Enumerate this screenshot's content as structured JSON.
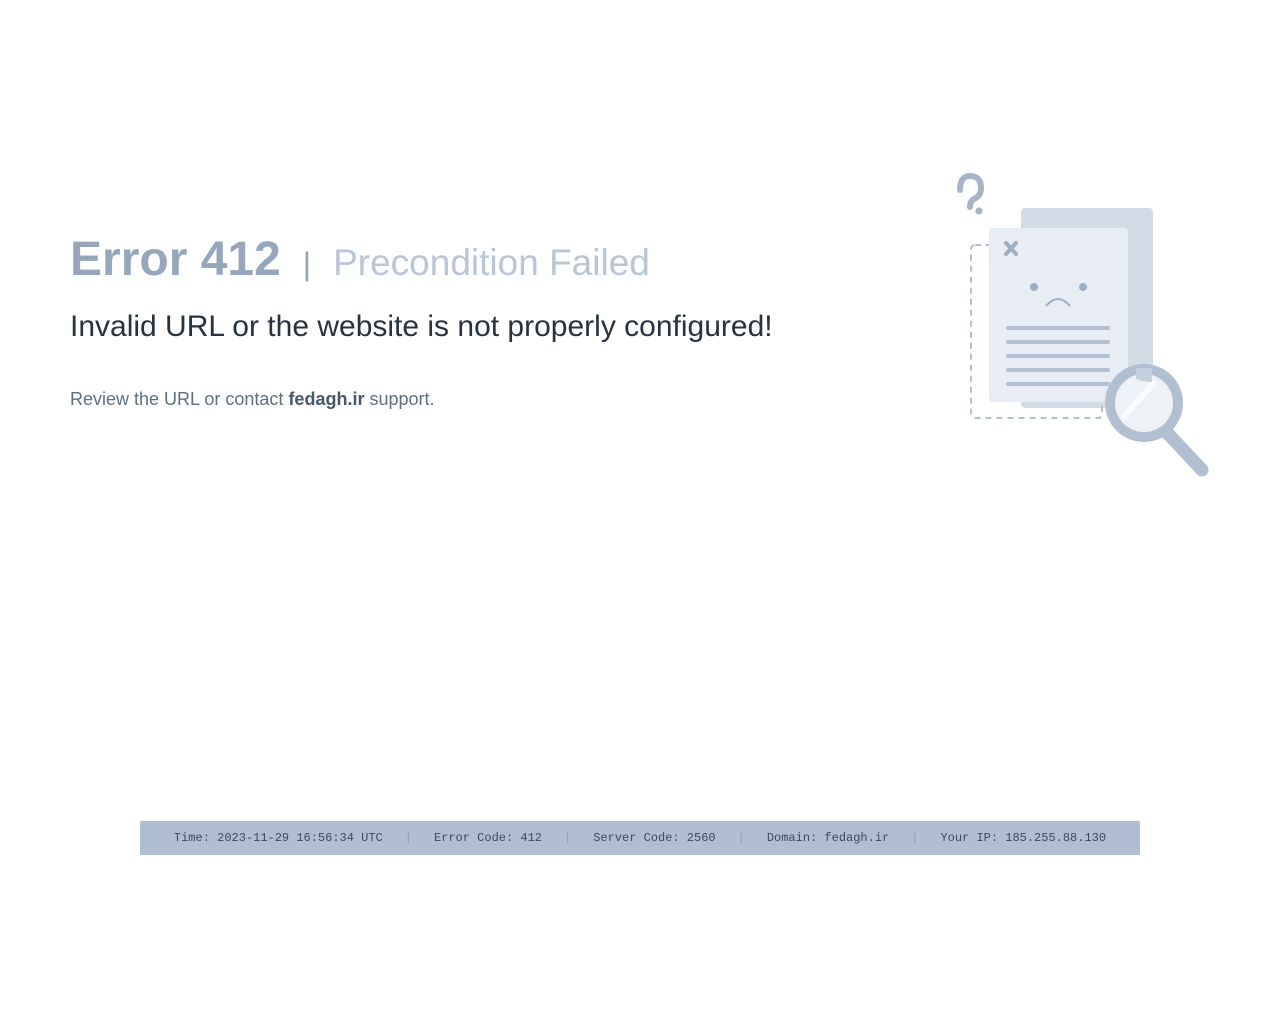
{
  "error": {
    "code_label": "Error 412",
    "separator": "|",
    "title": "Precondition Failed"
  },
  "message": "Invalid URL or the website is not properly configured!",
  "hint": {
    "prefix": "Review the URL or contact ",
    "domain": "fedagh.ir",
    "suffix": " support."
  },
  "illustration": {
    "icon": "document-not-found-icon"
  },
  "footer": {
    "separator": "|",
    "time": "Time: 2023-11-29 16:56:34 UTC",
    "error_code": "Error Code: 412",
    "server_code": "Server Code: 2560",
    "domain": "Domain: fedagh.ir",
    "ip": "Your IP: 185.255.88.130"
  },
  "colors": {
    "footer_bg": "#afbed2",
    "heading_gray": "#96a6bb",
    "title_light": "#b8c6d6",
    "text_dark": "#27333f"
  }
}
